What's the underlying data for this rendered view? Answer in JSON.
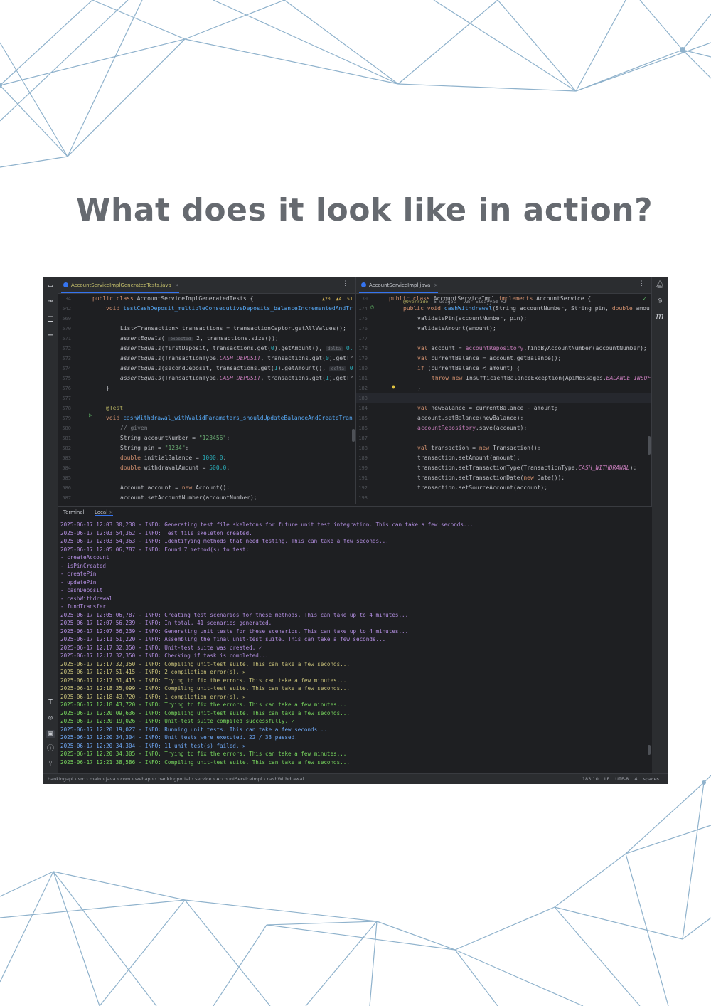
{
  "heading": "What does it look like in action?",
  "colors": {
    "accent": "#3574f0",
    "bg": "#1e1f22",
    "decor": "#8fb2cc",
    "info_purple": "#b28ee0",
    "info_olive": "#c9c27a",
    "info_green": "#78d75e",
    "info_blue": "#6fa8f5"
  },
  "left_editor": {
    "tab": "AccountServiceImplGeneratedTests.java",
    "inspection": "▲20  ▲4  ✎1",
    "line_numbers": [
      "34",
      "542",
      "569",
      "570",
      "571",
      "572",
      "573",
      "574",
      "575",
      "576",
      "577",
      "578",
      "579",
      "580",
      "581",
      "582",
      "583",
      "584",
      "585",
      "586",
      "587"
    ]
  },
  "right_editor": {
    "tab": "AccountServiceImpl.java",
    "usages": "5 usages   Amr Elsayyad +2",
    "line_numbers": [
      "30",
      "174",
      "175",
      "176",
      "177",
      "178",
      "179",
      "180",
      "181",
      "182",
      "183",
      "184",
      "185",
      "186",
      "187",
      "188",
      "189",
      "190",
      "191",
      "192",
      "193"
    ]
  },
  "terminal": {
    "tabs": [
      "Terminal",
      "Local"
    ],
    "lines": [
      {
        "t": "2025-06-17 12:03:30,238 - INFO: Generating test file skeletons for future unit test integration. This can take a few seconds...",
        "c": "p"
      },
      {
        "t": "2025-06-17 12:03:54,362 - INFO: Test file skeleton created.",
        "c": "p"
      },
      {
        "t": "2025-06-17 12:03:54,363 - INFO: Identifying methods that need testing. This can take a few seconds...",
        "c": "p"
      },
      {
        "t": "2025-06-17 12:05:06,787 - INFO: Found 7 method(s) to test:",
        "c": "p"
      },
      {
        "t": "- createAccount",
        "c": "p"
      },
      {
        "t": "- isPinCreated",
        "c": "p"
      },
      {
        "t": "- createPin",
        "c": "p"
      },
      {
        "t": "- updatePin",
        "c": "p"
      },
      {
        "t": "- cashDeposit",
        "c": "p"
      },
      {
        "t": "- cashWithdrawal",
        "c": "p"
      },
      {
        "t": "- fundTransfer",
        "c": "p"
      },
      {
        "t": "2025-06-17 12:05:06,787 - INFO: Creating test scenarios for these methods. This can take up to 4 minutes...",
        "c": "p"
      },
      {
        "t": "2025-06-17 12:07:56,239 - INFO: In total, 41 scenarios generated.",
        "c": "p"
      },
      {
        "t": "2025-06-17 12:07:56,239 - INFO: Generating unit tests for these scenarios. This can take up to 4 minutes...",
        "c": "p"
      },
      {
        "t": "2025-06-17 12:11:51,220 - INFO: Assembling the final unit-test suite. This can take a few seconds...",
        "c": "p"
      },
      {
        "t": "2025-06-17 12:17:32,350 - INFO: Unit-test suite was created. ✓",
        "c": "p"
      },
      {
        "t": "2025-06-17 12:17:32,350 - INFO: Checking if task is completed...",
        "c": "p"
      },
      {
        "t": "2025-06-17 12:17:32,350 - INFO: Compiling unit-test suite. This can take a few seconds...",
        "c": "o"
      },
      {
        "t": "2025-06-17 12:17:51,415 - INFO: 2 compilation error(s). ✕",
        "c": "o"
      },
      {
        "t": "2025-06-17 12:17:51,415 - INFO: Trying to fix the errors. This can take a few minutes...",
        "c": "o"
      },
      {
        "t": "2025-06-17 12:18:35,099 - INFO: Compiling unit-test suite. This can take a few seconds...",
        "c": "o"
      },
      {
        "t": "2025-06-17 12:18:43,720 - INFO: 1 compilation error(s). ✕",
        "c": "o"
      },
      {
        "t": "2025-06-17 12:18:43,720 - INFO: Trying to fix the errors. This can take a few minutes...",
        "c": "g"
      },
      {
        "t": "2025-06-17 12:20:09,636 - INFO: Compiling unit-test suite. This can take a few seconds...",
        "c": "g"
      },
      {
        "t": "2025-06-17 12:20:19,026 - INFO: Unit-test suite compiled successfully. ✓",
        "c": "g"
      },
      {
        "t": "2025-06-17 12:20:19,027 - INFO: Running unit tests. This can take a few seconds...",
        "c": "b"
      },
      {
        "t": "2025-06-17 12:20:34,304 - INFO: Unit tests were executed. 22 / 33 passed.",
        "c": "b"
      },
      {
        "t": "2025-06-17 12:20:34,304 - INFO: 11 unit test(s) failed. ✕",
        "c": "b"
      },
      {
        "t": "2025-06-17 12:20:34,305 - INFO: Trying to fix the errors. This can take a few minutes...",
        "c": "g"
      },
      {
        "t": "2025-06-17 12:21:38,586 - INFO: Compiling unit-test suite. This can take a few seconds...",
        "c": "g"
      }
    ]
  },
  "status": {
    "crumbs": [
      "bankingapi",
      "src",
      "main",
      "java",
      "com",
      "webapp",
      "bankingportal",
      "service",
      "AccountServiceImpl",
      "cashWithdrawal"
    ],
    "position": "183:10",
    "line_sep": "LF",
    "encoding": "UTF-8",
    "indent": "4 spaces"
  }
}
